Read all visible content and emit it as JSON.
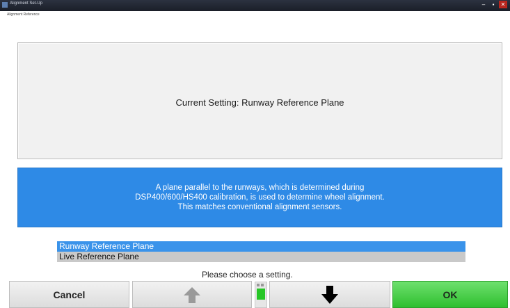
{
  "window": {
    "title": "Alignment Set-Up",
    "screen_label": "Alignment Reference",
    "minimize_glyph": "–",
    "maximize_glyph": "▪",
    "close_glyph": "✕"
  },
  "setting": {
    "text": "Current Setting:  Runway Reference Plane"
  },
  "description": {
    "lines": [
      "A plane parallel to the runways, which is determined during",
      "DSP400/600/HS400 calibration, is used to determine wheel alignment.",
      "This matches conventional alignment sensors."
    ]
  },
  "options": [
    {
      "label": "Runway Reference Plane",
      "selected": true
    },
    {
      "label": "Live Reference Plane",
      "selected": false
    }
  ],
  "prompt": "Please choose a setting.",
  "buttons": {
    "cancel": "Cancel",
    "ok": "OK",
    "up_icon": "arrow-up-icon",
    "down_icon": "arrow-down-icon"
  },
  "colors": {
    "description_bg": "#2e8ae6",
    "selected_option": "#3a93ea",
    "ok_button": "#3cc83c",
    "up_arrow": "#9a9a9a",
    "down_arrow": "#000000"
  }
}
